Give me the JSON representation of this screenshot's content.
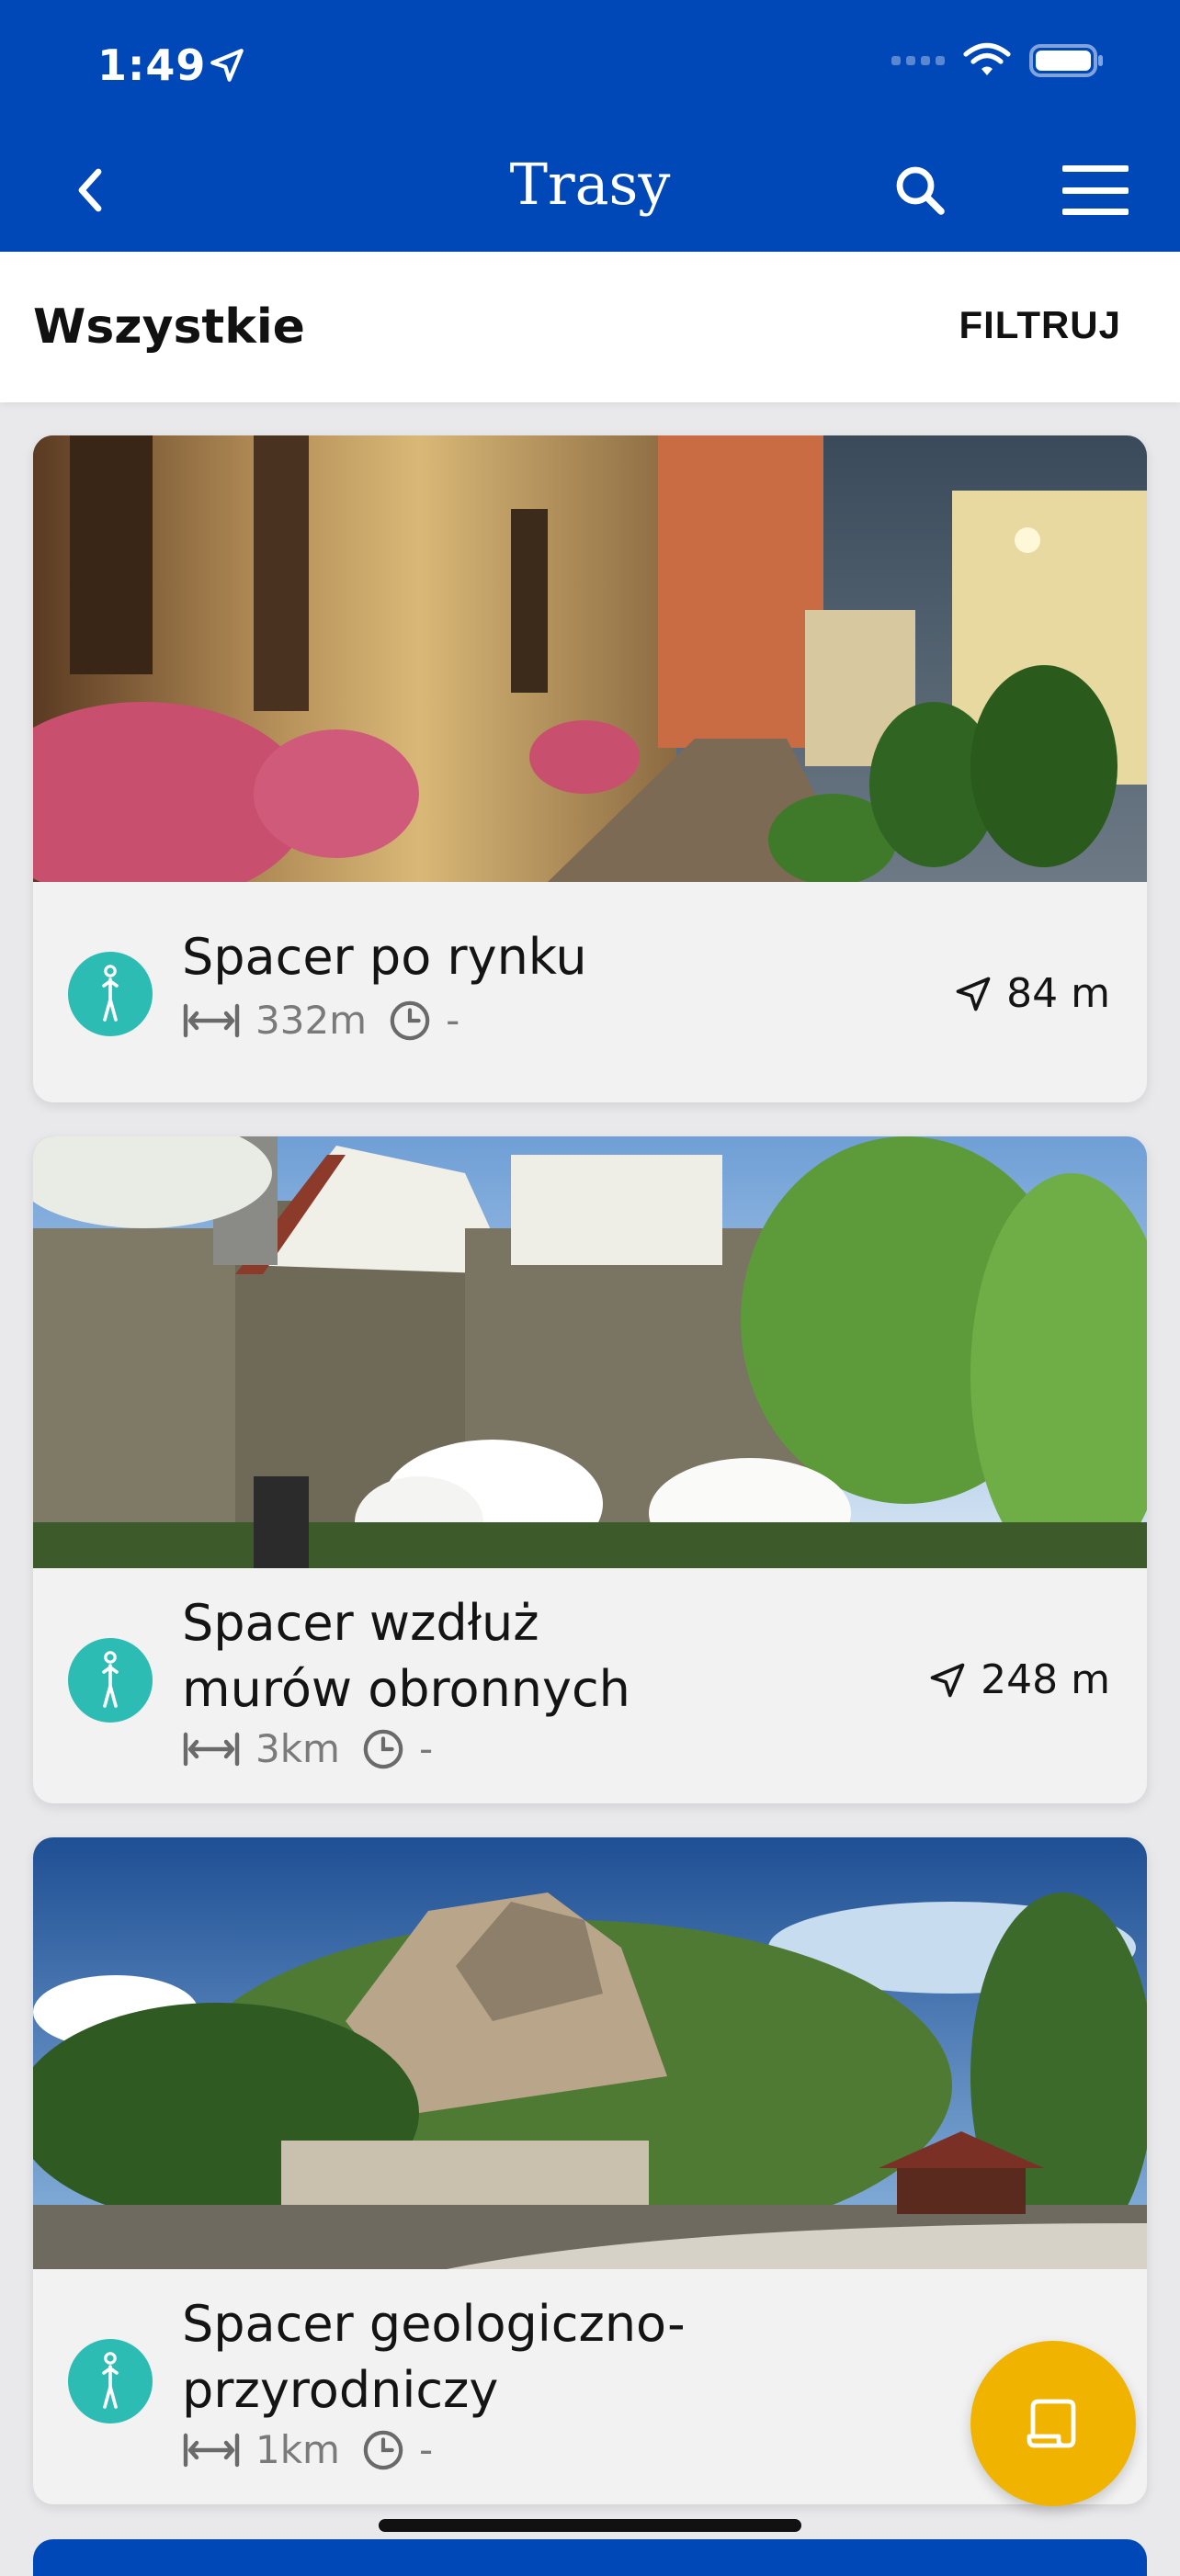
{
  "status_bar": {
    "time": "1:49"
  },
  "header": {
    "title": "Trasy"
  },
  "filter_bar": {
    "tab_label": "Wszystkie",
    "filter_label": "FILTRUJ"
  },
  "routes": [
    {
      "title": "Spacer po rynku",
      "length": "332m",
      "time": "-",
      "distance": "84 m",
      "type_icon": "walking-person-icon",
      "image": "old-town-street-with-flowers"
    },
    {
      "title_line1": "Spacer wzdłuż",
      "title_line2": "murów obronnych",
      "length": "3km",
      "time": "-",
      "distance": "248 m",
      "type_icon": "walking-person-icon",
      "image": "defensive-walls-tower"
    },
    {
      "title_line1": "Spacer geologiczno-",
      "title_line2": "przyrodniczy",
      "length": "1km",
      "time": "-",
      "type_icon": "walking-person-icon",
      "image": "rock-hill-forest"
    }
  ],
  "colors": {
    "header_blue": "#0047b8",
    "walk_teal": "#2dbcb3",
    "fab_yellow": "#f0b400"
  }
}
